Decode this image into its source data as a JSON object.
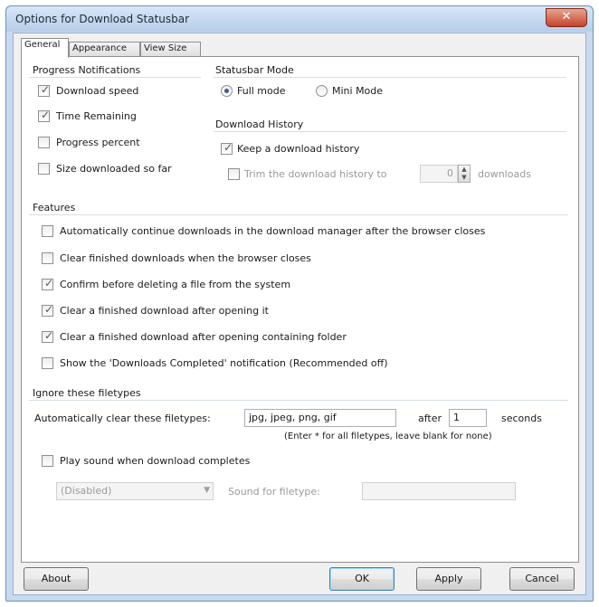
{
  "window": {
    "title": "Options for Download Statusbar",
    "close_glyph": "✕"
  },
  "tabs": [
    {
      "label": "General"
    },
    {
      "label": "Appearance"
    },
    {
      "label": "View Size"
    }
  ],
  "progress_notifications": {
    "title": "Progress Notifications",
    "items": [
      {
        "label": "Download speed",
        "checked": true
      },
      {
        "label": "Time Remaining",
        "checked": true
      },
      {
        "label": "Progress percent",
        "checked": false
      },
      {
        "label": "Size downloaded so far",
        "checked": false
      }
    ]
  },
  "statusbar_mode": {
    "title": "Statusbar Mode",
    "options": [
      {
        "label": "Full mode",
        "selected": true
      },
      {
        "label": "Mini Mode",
        "selected": false
      }
    ]
  },
  "download_history": {
    "title": "Download History",
    "keep_label": "Keep a download history",
    "keep_checked": true,
    "trim_label": "Trim the download history to",
    "trim_checked": false,
    "trim_value": "0",
    "trim_suffix": "downloads"
  },
  "features": {
    "title": "Features",
    "items": [
      {
        "label": "Automatically continue downloads in the download manager after the browser closes",
        "checked": false
      },
      {
        "label": "Clear finished downloads when the browser closes",
        "checked": false
      },
      {
        "label": "Confirm before deleting a file from the system",
        "checked": true
      },
      {
        "label": "Clear a finished download after opening it",
        "checked": true
      },
      {
        "label": "Clear a finished download after opening containing folder",
        "checked": true
      },
      {
        "label": "Show the 'Downloads Completed' notification (Recommended off)",
        "checked": false
      }
    ]
  },
  "ignore_filetypes": {
    "title": "Ignore these filetypes",
    "auto_clear_label": "Automatically clear these filetypes:",
    "filetypes_value": "jpg, jpeg, png, gif",
    "after_label": "after",
    "seconds_value": "1",
    "seconds_label": "seconds",
    "hint": "(Enter * for all filetypes, leave blank for none)",
    "play_sound_label": "Play sound when download completes",
    "play_sound_checked": false,
    "sound_select_value": "(Disabled)",
    "sound_file_label": "Sound for filetype:",
    "sound_file_value": ""
  },
  "buttons": {
    "about": "About",
    "ok": "OK",
    "apply": "Apply",
    "cancel": "Cancel"
  },
  "colors": {
    "window_frame": "#c9d9ee",
    "close_button": "#c4442b",
    "panel_background": "#ffffff"
  }
}
